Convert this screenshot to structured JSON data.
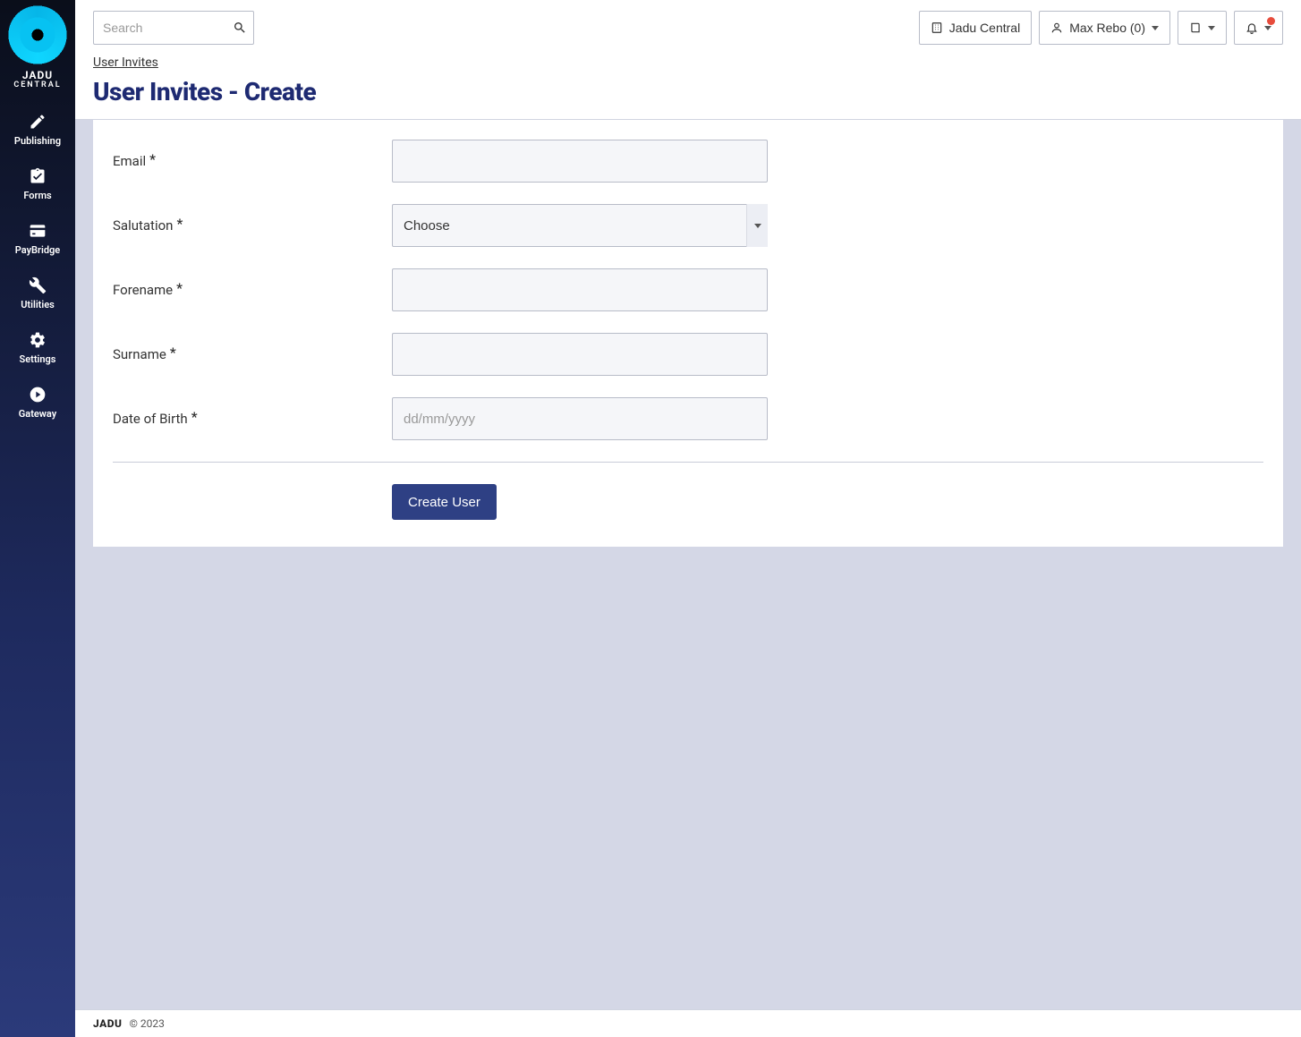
{
  "brand": {
    "name": "JADU",
    "sub": "CENTRAL"
  },
  "sidebar": {
    "items": [
      {
        "label": "Publishing",
        "icon": "pencil"
      },
      {
        "label": "Forms",
        "icon": "clipboard"
      },
      {
        "label": "PayBridge",
        "icon": "card"
      },
      {
        "label": "Utilities",
        "icon": "wrench"
      },
      {
        "label": "Settings",
        "icon": "gear"
      },
      {
        "label": "Gateway",
        "icon": "circle-arrow"
      }
    ]
  },
  "header": {
    "search_placeholder": "Search",
    "app_button": "Jadu Central",
    "user_button": "Max Rebo (0)"
  },
  "breadcrumb": {
    "link": "User Invites"
  },
  "page_title": "User Invites - Create",
  "form": {
    "email_label": "Email",
    "salutation_label": "Salutation",
    "salutation_selected": "Choose",
    "forename_label": "Forename",
    "surname_label": "Surname",
    "dob_label": "Date of Birth",
    "dob_placeholder": "dd/mm/yyyy",
    "submit_label": "Create User",
    "required_marker": "*"
  },
  "footer": {
    "brand": "JADU",
    "copyright": "© 2023"
  }
}
